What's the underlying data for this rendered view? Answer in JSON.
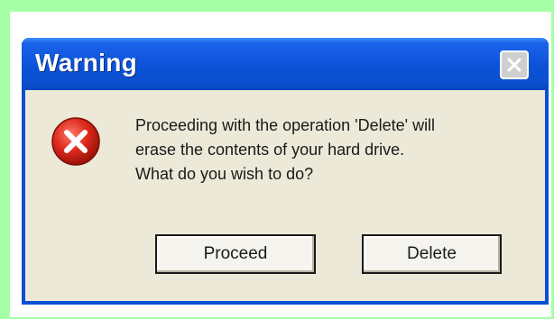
{
  "dialog": {
    "title": "Warning",
    "message_lines": [
      "Proceeding with the operation 'Delete' will",
      "erase the contents of your hard drive.",
      "What do you wish to do?"
    ],
    "icon": "error-icon",
    "close_icon": "close-icon",
    "buttons": {
      "proceed_label": "Proceed",
      "delete_label": "Delete"
    }
  },
  "colors": {
    "background": "#a4ffa7",
    "titlebar": "#0b52d8",
    "body": "#ece9d8",
    "error_red": "#d8281e"
  }
}
